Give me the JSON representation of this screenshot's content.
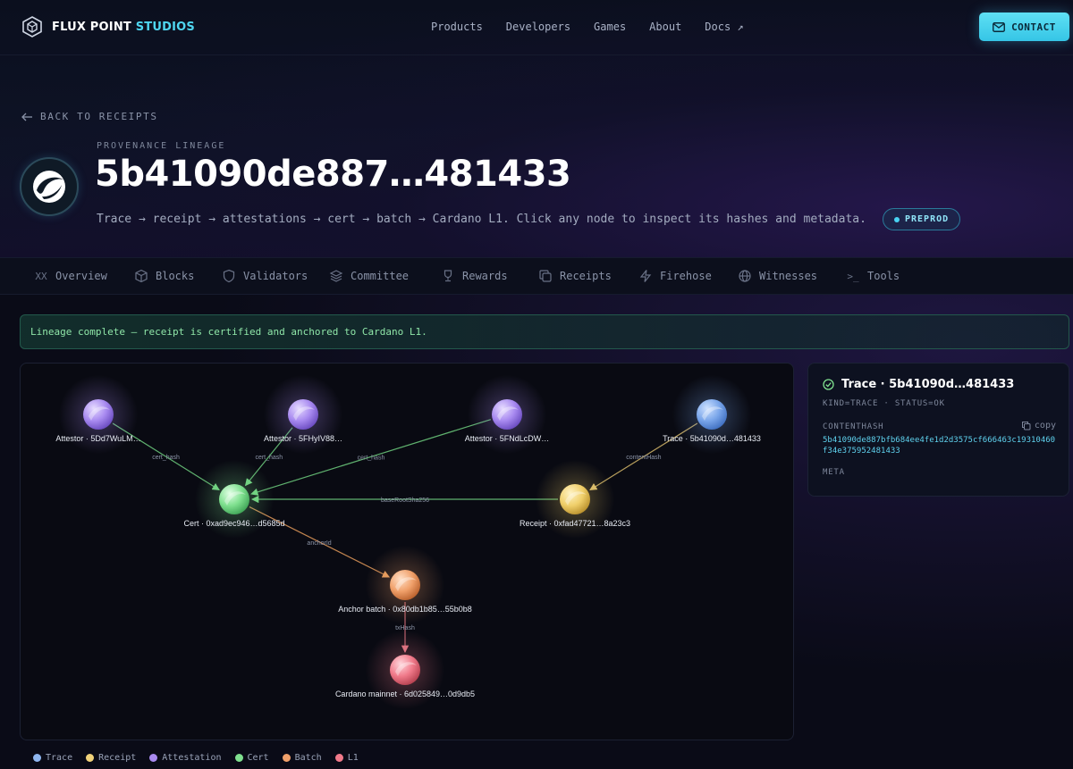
{
  "brand": {
    "name_part1": "FLUX POINT",
    "name_part2": "STUDIOS"
  },
  "nav": {
    "links": [
      "Products",
      "Developers",
      "Games",
      "About",
      "Docs ↗"
    ],
    "contact_label": "CONTACT"
  },
  "header": {
    "back_label": "BACK TO RECEIPTS",
    "eyebrow": "PROVENANCE LINEAGE",
    "title": "5b41090de887…481433",
    "subtitle": "Trace → receipt → attestations → cert → batch → Cardano L1. Click any node to inspect its hashes and metadata.",
    "network_badge": "PREPROD"
  },
  "tabs": [
    {
      "label": "Overview",
      "icon": "xx-icon"
    },
    {
      "label": "Blocks",
      "icon": "cube-icon"
    },
    {
      "label": "Validators",
      "icon": "shield-icon"
    },
    {
      "label": "Committee",
      "icon": "layers-icon"
    },
    {
      "label": "Rewards",
      "icon": "trophy-icon"
    },
    {
      "label": "Receipts",
      "icon": "copy-icon"
    },
    {
      "label": "Firehose",
      "icon": "bolt-icon"
    },
    {
      "label": "Witnesses",
      "icon": "globe-icon"
    },
    {
      "label": "Tools",
      "icon": "terminal-icon"
    }
  ],
  "alert": {
    "text": "Lineage complete — receipt is certified and anchored to Cardano L1."
  },
  "graph": {
    "nodes": [
      {
        "id": "att1",
        "kind": "Attestation",
        "label": "Attestor · 5Dd7WuLM…"
      },
      {
        "id": "att2",
        "kind": "Attestation",
        "label": "Attestor · 5FHyIV88…"
      },
      {
        "id": "att3",
        "kind": "Attestation",
        "label": "Attestor · 5FNdLcDW…"
      },
      {
        "id": "trace",
        "kind": "Trace",
        "label": "Trace · 5b41090d…481433"
      },
      {
        "id": "cert",
        "kind": "Cert",
        "label": "Cert · 0xad9ec946…d5685d"
      },
      {
        "id": "receipt",
        "kind": "Receipt",
        "label": "Receipt · 0xfad47721…8a23c3"
      },
      {
        "id": "batch",
        "kind": "Batch",
        "label": "Anchor batch · 0x80db1b85…55b0b8"
      },
      {
        "id": "l1",
        "kind": "L1",
        "label": "Cardano mainnet · 6d025849…0d9db5"
      }
    ],
    "edges": [
      {
        "from": "att1",
        "to": "cert",
        "label": "cert_hash"
      },
      {
        "from": "att2",
        "to": "cert",
        "label": "cert_hash"
      },
      {
        "from": "att3",
        "to": "cert",
        "label": "cert_hash"
      },
      {
        "from": "trace",
        "to": "receipt",
        "label": "contentHash"
      },
      {
        "from": "receipt",
        "to": "cert",
        "label": "baseRootSha256"
      },
      {
        "from": "cert",
        "to": "batch",
        "label": "anchorId"
      },
      {
        "from": "batch",
        "to": "l1",
        "label": "txHash"
      }
    ]
  },
  "legend": [
    {
      "label": "Trace",
      "color": "#8fb6f0"
    },
    {
      "label": "Receipt",
      "color": "#f0d27a"
    },
    {
      "label": "Attestation",
      "color": "#a98af0"
    },
    {
      "label": "Cert",
      "color": "#7fe08f"
    },
    {
      "label": "Batch",
      "color": "#f0a06a"
    },
    {
      "label": "L1",
      "color": "#f07a8a"
    }
  ],
  "inspector": {
    "title": "Trace · 5b41090d…481433",
    "kind_status": "KIND=TRACE · STATUS=OK",
    "content_hash_label": "CONTENTHASH",
    "copy_label": "copy",
    "content_hash": "5b41090de887bfb684ee4fe1d2d3575cf666463c19310460f34e375952481433",
    "meta_label": "META"
  },
  "colors": {
    "accent": "#4fd6f0",
    "trace": "#8fb6f0",
    "receipt": "#f0d27a",
    "attestation": "#a98af0",
    "cert": "#7fe08f",
    "batch": "#f0a06a",
    "l1": "#f07a8a"
  }
}
